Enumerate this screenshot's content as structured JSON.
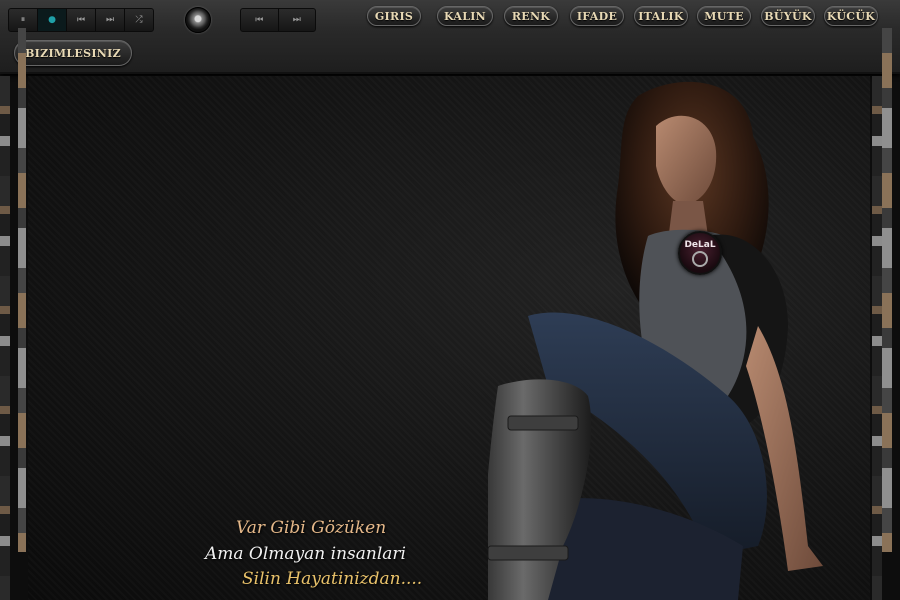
{
  "toolbar": {
    "player_buttons": [
      "⏸",
      "●",
      "⏮",
      "⏭",
      "⤮"
    ],
    "player2_buttons": [
      "⏮",
      "⏭"
    ],
    "nav": [
      {
        "label": "GIRIS"
      },
      {
        "label": "KALIN"
      },
      {
        "label": "RENK"
      },
      {
        "label": "IFADE"
      },
      {
        "label": "ITALIK"
      },
      {
        "label": "MUTE"
      },
      {
        "label": "BÜYÜK"
      },
      {
        "label": "KÜCÜK"
      }
    ],
    "bizimle": "BIZIMLESINIZ"
  },
  "badge": {
    "text": "DeLaL"
  },
  "poem": {
    "line1": "Var Gibi Gözüken",
    "line2": "Ama Olmayan insanlari",
    "line3": "Silin Hayatinizdan...."
  },
  "colors": {
    "pill_text": "#e8d9b5",
    "poem_line1": "#e6b98a",
    "poem_line2": "#f1f1f1",
    "poem_line3": "#e9c26a",
    "player_active": "#1fa0a8"
  },
  "icons": [
    "pause-icon",
    "play-indicator-icon",
    "previous-icon",
    "next-icon",
    "shuffle-icon",
    "volume-knob-icon"
  ]
}
